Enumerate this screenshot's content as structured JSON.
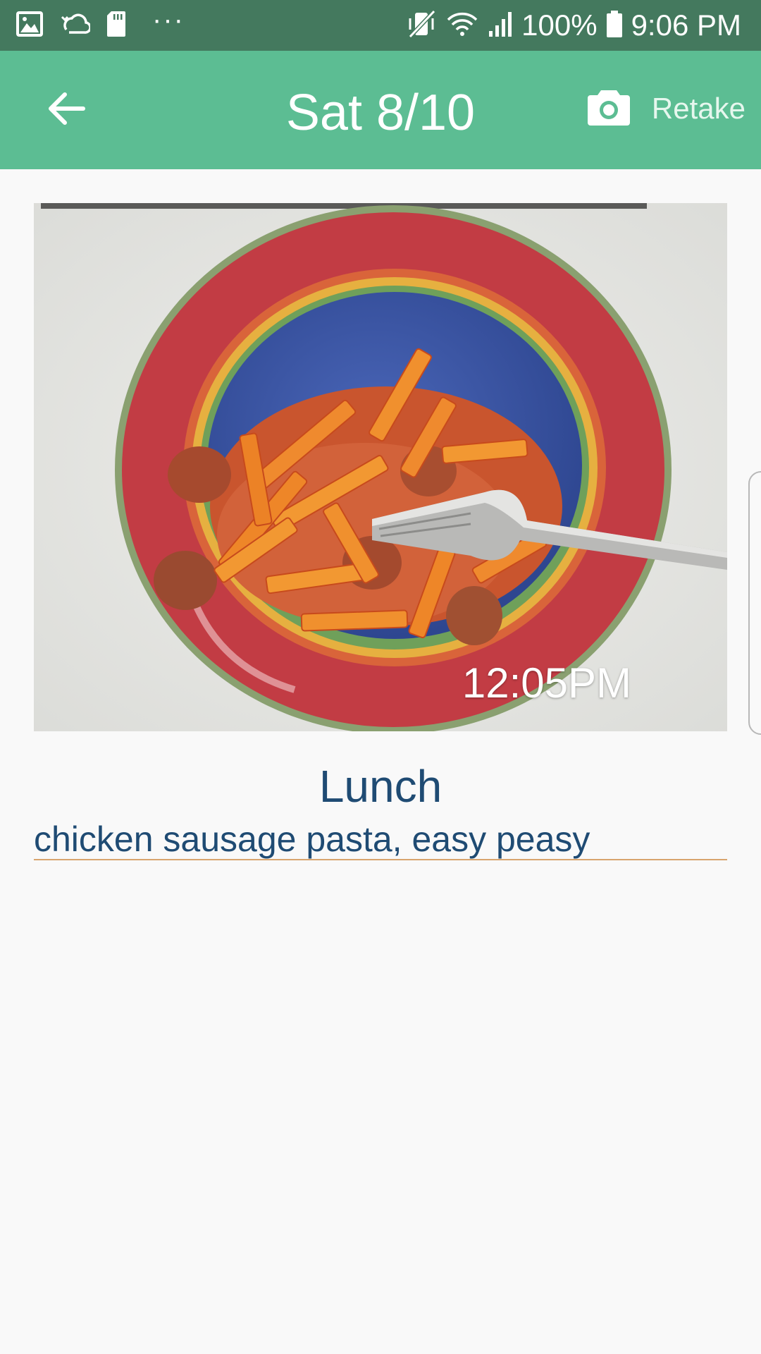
{
  "status_bar": {
    "battery": "100%",
    "time": "9:06 PM",
    "dots": "···",
    "bg_color": "#44795e"
  },
  "app_bar": {
    "title": "Sat 8/10",
    "retake_label": "Retake",
    "bg_color": "#5cbd93"
  },
  "photo": {
    "time_label": "12:05PM"
  },
  "meal": {
    "type": "Lunch",
    "notes": "chicken sausage pasta, easy peasy",
    "text_color": "#1f4b73"
  }
}
